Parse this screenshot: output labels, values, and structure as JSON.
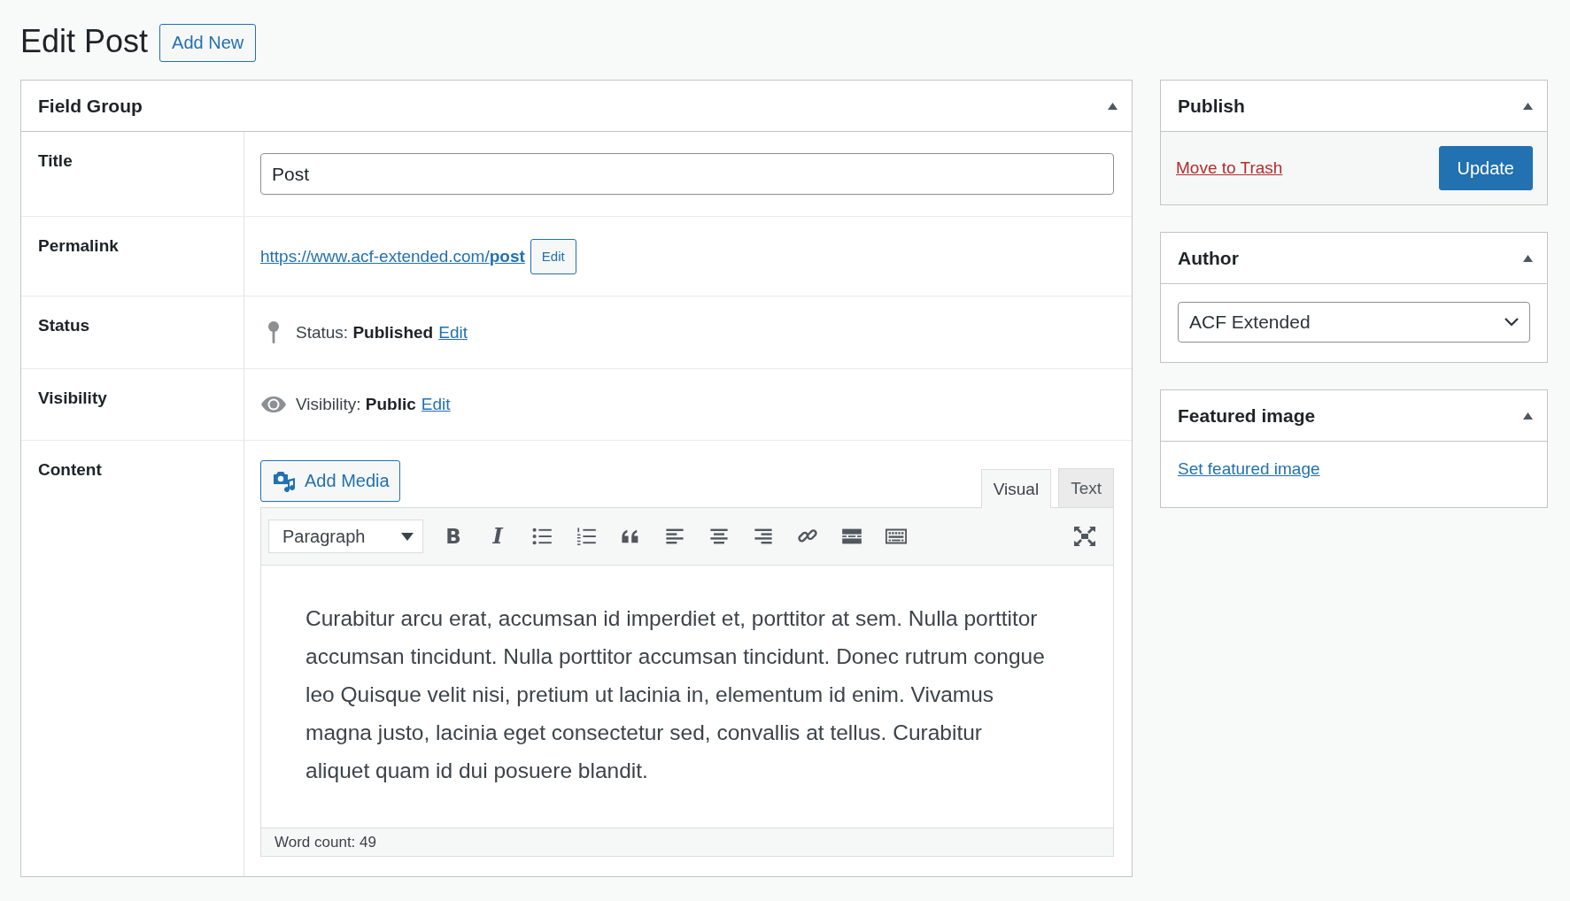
{
  "page": {
    "title": "Edit Post",
    "add_new": "Add New"
  },
  "field_group": {
    "title": "Field Group",
    "expanded": true,
    "title_row": {
      "label": "Title",
      "value": "Post"
    },
    "permalink_row": {
      "label": "Permalink",
      "url": "https://www.acf-extended.com/**post**",
      "edit": "Edit"
    },
    "status_row": {
      "label": "Status",
      "text": "Status: **Published**",
      "edit": "Edit"
    },
    "visibility_row": {
      "label": "Visibility",
      "text": "Visibility: **Public**",
      "edit": "Edit"
    },
    "content_row": {
      "label": "Content",
      "add_media": "Add Media",
      "tabs": [
        {
          "label": "Visual",
          "selected": true
        },
        {
          "label": "Text",
          "selected": false
        }
      ],
      "format": "Paragraph",
      "toolbar": [
        {
          "kind": "bold",
          "glyph": "B"
        },
        {
          "kind": "italic",
          "glyph": "I"
        },
        {
          "kind": "bullet-list"
        },
        {
          "kind": "numbered-list"
        },
        {
          "kind": "quote"
        },
        {
          "kind": "align-left"
        },
        {
          "kind": "align-center"
        },
        {
          "kind": "align-right"
        },
        {
          "kind": "link"
        },
        {
          "kind": "read-more"
        },
        {
          "kind": "toolbar-toggle"
        }
      ],
      "text": "Curabitur arcu erat, accumsan id imperdiet et, porttitor at sem. Nulla porttitor accumsan tincidunt. Nulla porttitor accumsan tincidunt. Donec rutrum congue leo Quisque velit nisi, pretium ut lacinia in, elementum id enim. Vivamus magna justo, lacinia eget consectetur sed, convallis at tellus. Curabitur aliquet quam id dui posuere blandit.",
      "word_count": "Word count: 49"
    }
  },
  "sidebar": [
    {
      "kind": "publish",
      "title": "Publish",
      "expanded": true,
      "trash": "Move to Trash",
      "button": "Update"
    },
    {
      "kind": "author",
      "title": "Author",
      "expanded": true,
      "value": "ACF Extended"
    },
    {
      "kind": "featured",
      "title": "Featured image",
      "expanded": true,
      "link": "Set featured image"
    }
  ]
}
